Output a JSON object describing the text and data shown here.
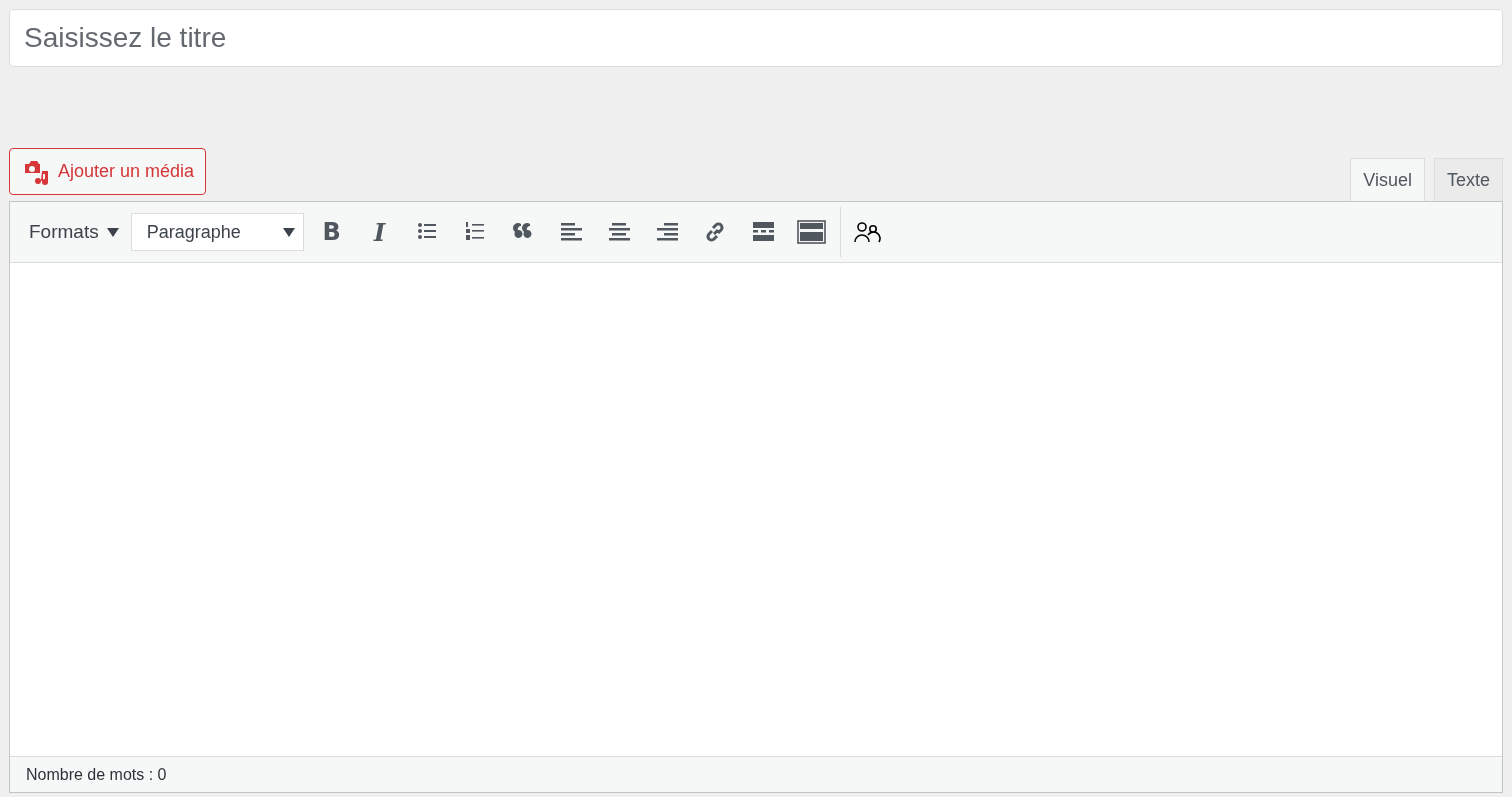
{
  "title_field": {
    "placeholder": "Saisissez le titre"
  },
  "media_button": {
    "label": "Ajouter un média"
  },
  "tabs": [
    {
      "label": "Visuel",
      "selected": true
    },
    {
      "label": "Texte",
      "selected": false
    }
  ],
  "toolbar": {
    "formats_menu": "Formats",
    "block_select": "Paragraphe",
    "buttons": [
      {
        "kind": "bold",
        "label": "B"
      },
      {
        "kind": "italic",
        "label": "I"
      },
      {
        "kind": "bullet-list"
      },
      {
        "kind": "numbered-list"
      },
      {
        "kind": "quote"
      },
      {
        "kind": "align-left"
      },
      {
        "kind": "align-center"
      },
      {
        "kind": "align-right"
      },
      {
        "kind": "link"
      },
      {
        "kind": "read-more"
      },
      {
        "kind": "toolbar-toggle"
      },
      {
        "kind": "separator"
      },
      {
        "kind": "people"
      }
    ]
  },
  "status_bar": {
    "word_count": "Nombre de mots : 0"
  }
}
